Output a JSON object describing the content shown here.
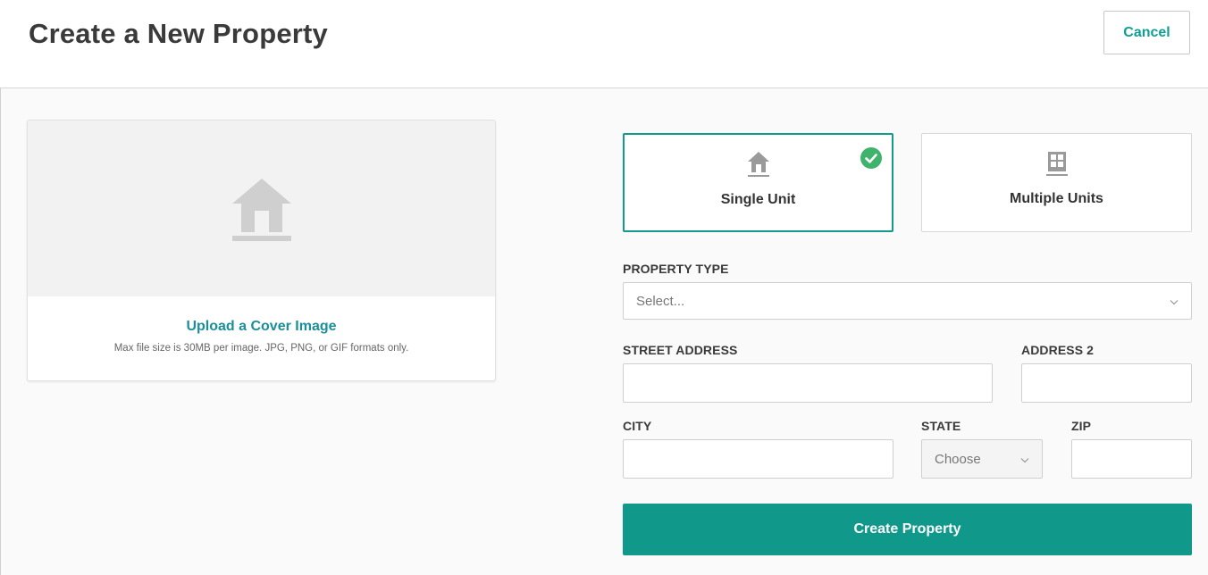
{
  "header": {
    "title": "Create a New Property",
    "cancel_label": "Cancel"
  },
  "upload": {
    "link_label": "Upload a Cover Image",
    "note": "Max file size is 30MB per image. JPG, PNG, or GIF formats only.",
    "icon": "house-icon"
  },
  "unit_types": {
    "single": {
      "label": "Single Unit",
      "icon": "house-icon",
      "selected": true
    },
    "multiple": {
      "label": "Multiple Units",
      "icon": "building-icon",
      "selected": false
    }
  },
  "form": {
    "property_type": {
      "label": "PROPERTY TYPE",
      "placeholder": "Select..."
    },
    "street_address": {
      "label": "STREET ADDRESS",
      "value": ""
    },
    "address2": {
      "label": "ADDRESS 2",
      "value": ""
    },
    "city": {
      "label": "CITY",
      "value": ""
    },
    "state": {
      "label": "STATE",
      "placeholder": "Choose"
    },
    "zip": {
      "label": "ZIP",
      "value": ""
    },
    "submit_label": "Create Property"
  },
  "colors": {
    "accent": "#10998b",
    "link": "#1a8f9a",
    "check": "#3fb36b"
  }
}
